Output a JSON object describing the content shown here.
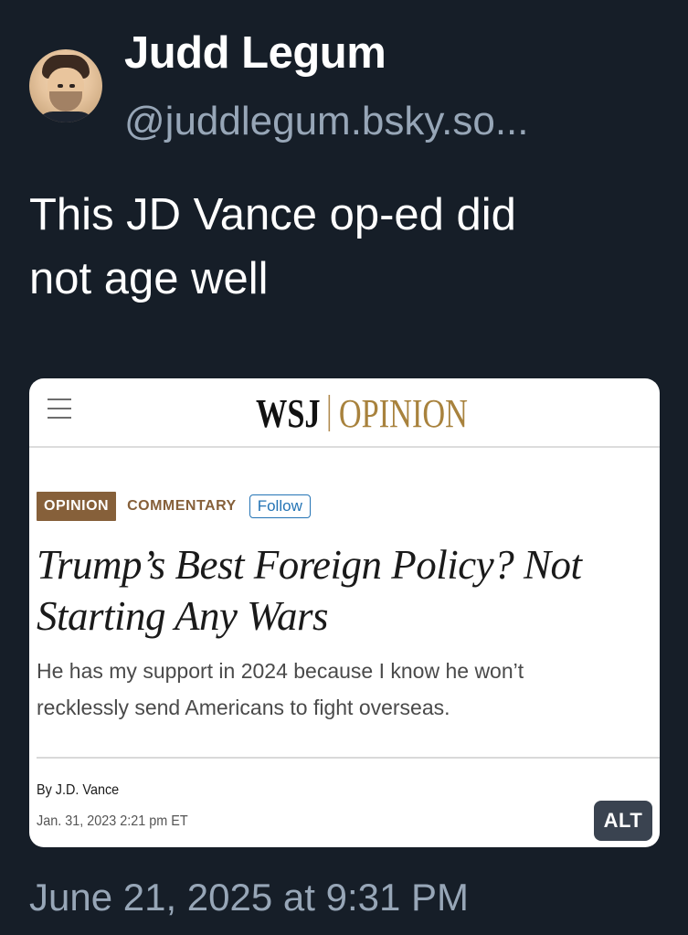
{
  "post": {
    "author": {
      "display_name": "Judd Legum",
      "handle": "@juddlegum.bsky.so..."
    },
    "text_line1": "This JD Vance op-ed did",
    "text_line2": "not age well",
    "timestamp": "June 21, 2025 at 9:31 PM",
    "alt_badge": "ALT"
  },
  "embed": {
    "masthead": {
      "wsj": "WSJ",
      "section": "OPINION"
    },
    "labels": {
      "opinion": "OPINION",
      "commentary": "COMMENTARY",
      "follow": "Follow"
    },
    "headline_line1": "Trump’s Best Foreign Policy? Not",
    "headline_line2": "Starting Any Wars",
    "dek_line1": "He has my support in 2024 because I know he won’t",
    "dek_line2": "recklessly send Americans to fight overseas.",
    "byline": "By J.D. Vance",
    "dateline": "Jan. 31, 2023 2:21 pm ET"
  },
  "icons": {
    "menu": "hamburger-menu-icon",
    "avatar": "avatar"
  },
  "colors": {
    "background": "#161e28",
    "secondary_text": "#97a6b7",
    "wsj_gold": "#a8823d",
    "opinion_tag": "#86603a",
    "follow_blue": "#2474b5"
  }
}
